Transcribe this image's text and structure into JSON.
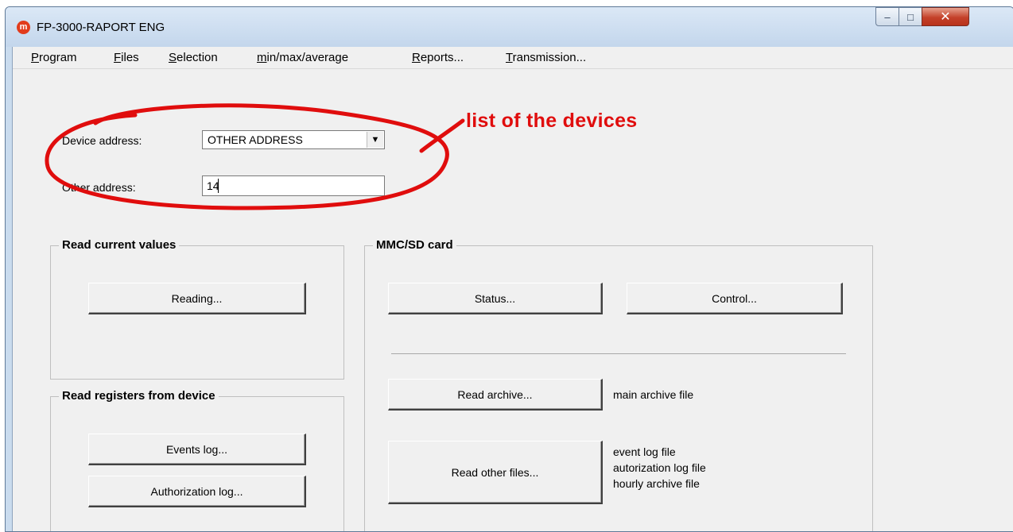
{
  "window": {
    "title": "FP-3000-RAPORT ENG",
    "icon": "m",
    "controls": {
      "minimize": "–",
      "maximize": "□",
      "close": "✕"
    }
  },
  "menu": [
    "Program",
    "Files",
    "Selection",
    "min/max/average",
    "Reports...",
    "Transmission..."
  ],
  "form": {
    "device_address_label": "Device address:",
    "device_address_value": "OTHER ADDRESS",
    "other_address_label": "Other address:",
    "other_address_value": "14"
  },
  "annotation": {
    "text": "list of the devices",
    "color": "#e00d0d"
  },
  "groups": {
    "current_values": {
      "title": "Read current values",
      "reading_button": "Reading..."
    },
    "registers": {
      "title": "Read registers from device",
      "events_button": "Events log...",
      "authorization_button": "Authorization log..."
    },
    "mmc": {
      "title": "MMC/SD card",
      "status_button": "Status...",
      "control_button": "Control...",
      "read_archive_button": "Read archive...",
      "read_archive_desc": "main archive file",
      "read_other_button": "Read other files...",
      "read_other_desc": [
        "event log file",
        "autorization log file",
        "hourly archive file"
      ]
    }
  }
}
